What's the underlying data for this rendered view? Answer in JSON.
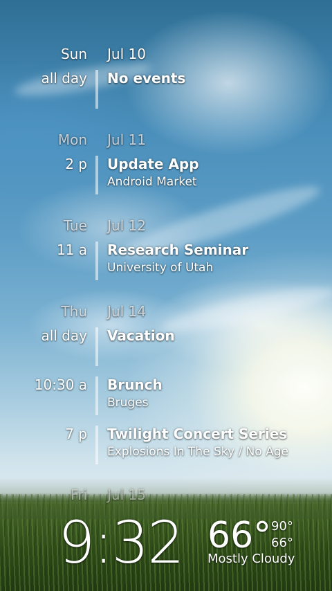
{
  "days": [
    {
      "dow": "Sun",
      "date": "Jul 10",
      "events": [
        {
          "time": "all day",
          "title": "No events",
          "subtitle": ""
        }
      ]
    },
    {
      "dow": "Mon",
      "date": "Jul 11",
      "events": [
        {
          "time": "2 p",
          "title": "Update App",
          "subtitle": "Android Market"
        }
      ]
    },
    {
      "dow": "Tue",
      "date": "Jul 12",
      "events": [
        {
          "time": "11 a",
          "title": "Research Seminar",
          "subtitle": "University of Utah"
        }
      ]
    },
    {
      "dow": "Thu",
      "date": "Jul 14",
      "events": [
        {
          "time": "all day",
          "title": "Vacation",
          "subtitle": ""
        },
        {
          "time": "10:30 a",
          "title": "Brunch",
          "subtitle": "Bruges"
        },
        {
          "time": "7 p",
          "title": "Twilight Concert Series",
          "subtitle": "Explosions In The Sky / No Age"
        }
      ]
    },
    {
      "dow": "Fri",
      "date": "Jul 15",
      "events": []
    }
  ],
  "clock": {
    "time": "9:32"
  },
  "weather": {
    "temp": "66°",
    "high": "90°",
    "low": "66°",
    "condition": "Mostly Cloudy"
  }
}
